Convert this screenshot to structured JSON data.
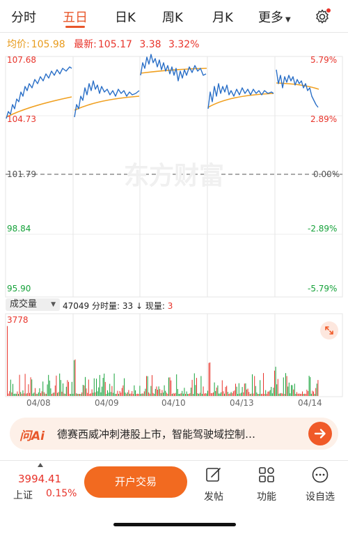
{
  "tabs": [
    "分时",
    "五日",
    "日K",
    "周K",
    "月K",
    "更多"
  ],
  "active_tab": "五日",
  "price_summary": {
    "avg_label": "均价:",
    "avg_value": "105.98",
    "latest_label": "最新:",
    "latest_value": "105.17",
    "change": "3.38",
    "change_pct": "3.32%"
  },
  "axis_left": [
    "107.68",
    "104.73",
    "101.79",
    "98.84",
    "95.90"
  ],
  "axis_right": [
    "5.79%",
    "2.89%",
    "0.00%",
    "-2.89%",
    "-5.79%"
  ],
  "watermark": "东方财富",
  "volume": {
    "selector_label": "成交量",
    "info": "47049 分时量: 33 ↓ 现量: 3",
    "info_value": "47049",
    "info_mid": "分时量: 33 ↓ 现量:",
    "info_current": "3",
    "max_label": "3778"
  },
  "dates": [
    "04/08",
    "04/09",
    "04/10",
    "04/13",
    "04/14"
  ],
  "ai_banner": {
    "logo": "问Ai",
    "text": "德赛西威冲刺港股上市，智能驾驶域控制…"
  },
  "index": {
    "value": "3994.41",
    "name": "上证",
    "change": "0.15%"
  },
  "trade_button": "开户交易",
  "nav": [
    "发帖",
    "功能",
    "设自选"
  ],
  "colors": {
    "accent": "#e8562a",
    "up": "#e8332a",
    "down": "#16a23a",
    "price_line": "#2a6fc7",
    "avg_line": "#f0a020"
  }
}
